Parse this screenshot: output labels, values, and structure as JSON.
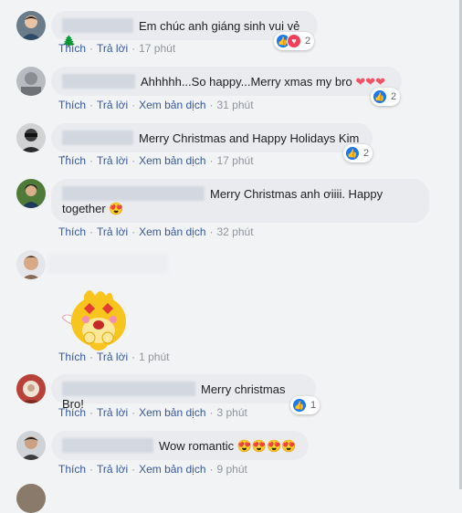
{
  "actions": {
    "like": "Thích",
    "reply": "Trả lời",
    "translate": "Xem bản dịch"
  },
  "comments": [
    {
      "text": "Em chúc anh giáng sinh vui vẻ",
      "tree": "🌲",
      "time": "17 phút",
      "reactions": "2"
    },
    {
      "text": "Ahhhhh...So happy...Merry xmas my bro",
      "hearts": "❤❤❤",
      "time": "31 phút",
      "reactions": "2"
    },
    {
      "text": "Merry Christmas and Happy Holidays Kim ..",
      "time": "17 phút",
      "reactions": "2"
    },
    {
      "text_line1": "Merry Christmas anh ơiiii. Happy",
      "text_line2": "together",
      "emoji": "😍",
      "time": "32 phút"
    },
    {
      "sticker": "Sticker",
      "time": "1 phút"
    },
    {
      "text": "Merry christmas Bro!",
      "time": "3 phút",
      "reactions": "1"
    },
    {
      "text": "Wow romantic",
      "emojis": "😍😍😍😍",
      "time": "9 phút"
    }
  ],
  "icons": {
    "like": "thumbs-up-icon",
    "love": "heart-icon"
  },
  "colors": {
    "link": "#385898",
    "bubble": "#e9ebee",
    "like": "#1877f2",
    "love": "#f33e58"
  }
}
